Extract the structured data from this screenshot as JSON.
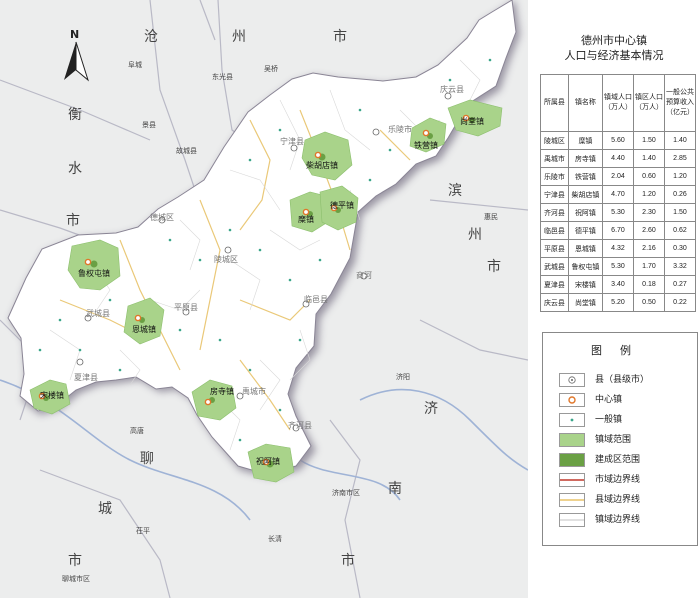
{
  "map": {
    "outside_labels": [
      {
        "id": "cang1",
        "text": "沧"
      },
      {
        "id": "zhou1",
        "text": "州"
      },
      {
        "id": "shi1",
        "text": "市"
      },
      {
        "id": "heng",
        "text": "衡"
      },
      {
        "id": "shui",
        "text": "水"
      },
      {
        "id": "shi2",
        "text": "市"
      },
      {
        "id": "bin",
        "text": "滨"
      },
      {
        "id": "zhou2",
        "text": "州"
      },
      {
        "id": "shi3",
        "text": "市"
      },
      {
        "id": "ji",
        "text": "济"
      },
      {
        "id": "nan",
        "text": "南"
      },
      {
        "id": "shi4",
        "text": "市"
      },
      {
        "id": "liao",
        "text": "聊"
      },
      {
        "id": "cheng",
        "text": "城"
      },
      {
        "id": "shi5",
        "text": "市"
      }
    ],
    "county_labels": [
      {
        "id": "ningjin",
        "text": "宁津县"
      },
      {
        "id": "laoling",
        "text": "乐陵市"
      },
      {
        "id": "qingyun",
        "text": "庆云县"
      },
      {
        "id": "decheng",
        "text": "德城区"
      },
      {
        "id": "lingcheng",
        "text": "陵城区"
      },
      {
        "id": "wucheng",
        "text": "武城县"
      },
      {
        "id": "pingyuan",
        "text": "平原县"
      },
      {
        "id": "linyi",
        "text": "临邑县"
      },
      {
        "id": "xiajin",
        "text": "夏津县"
      },
      {
        "id": "yucheng",
        "text": "禹城市"
      },
      {
        "id": "qihe",
        "text": "齐河县"
      },
      {
        "id": "shanghe",
        "text": "商河"
      }
    ],
    "outside_city_labels": [
      {
        "id": "jingxian",
        "text": "景县"
      },
      {
        "id": "gucheng",
        "text": "故城县"
      },
      {
        "id": "dongguang",
        "text": "东光县"
      },
      {
        "id": "fucheng",
        "text": "阜城"
      },
      {
        "id": "wuqiao",
        "text": "吴桥"
      },
      {
        "id": "huimin",
        "text": "惠民"
      },
      {
        "id": "jiyang",
        "text": "济阳"
      },
      {
        "id": "jinan",
        "text": "济南市区"
      },
      {
        "id": "changqing",
        "text": "长清"
      },
      {
        "id": "gaotang",
        "text": "高唐"
      },
      {
        "id": "chiping",
        "text": "茌平"
      },
      {
        "id": "liaocheng",
        "text": "聊城市区"
      }
    ],
    "towns": [
      {
        "id": "chaihudian",
        "text": "柴胡店镇"
      },
      {
        "id": "tiejia",
        "text": "铁营镇"
      },
      {
        "id": "shangtang",
        "text": "尚堂镇"
      },
      {
        "id": "deping",
        "text": "德平镇"
      },
      {
        "id": "mi",
        "text": "糜镇"
      },
      {
        "id": "luquantun",
        "text": "鲁权屯镇"
      },
      {
        "id": "encheng",
        "text": "恩城镇"
      },
      {
        "id": "songlou",
        "text": "宋楼镇"
      },
      {
        "id": "fangsi",
        "text": "房寺镇"
      },
      {
        "id": "zhuahe",
        "text": "祝阿镇"
      }
    ],
    "north": "N"
  },
  "panel": {
    "title_line1": "德州市中心镇",
    "title_line2": "人口与经济基本情况",
    "headers": [
      "所属县",
      "镇名称",
      "镇域人口（万人）",
      "镇区人口（万人）",
      "一般公共预算收入（亿元）"
    ],
    "rows": [
      [
        "陵城区",
        "糜镇",
        "5.60",
        "1.50",
        "1.40"
      ],
      [
        "禹城市",
        "房寺镇",
        "4.40",
        "1.40",
        "2.85"
      ],
      [
        "乐陵市",
        "铁营镇",
        "2.04",
        "0.60",
        "1.20"
      ],
      [
        "宁津县",
        "柴胡店镇",
        "4.70",
        "1.20",
        "0.26"
      ],
      [
        "齐河县",
        "祝阿镇",
        "5.30",
        "2.30",
        "1.50"
      ],
      [
        "临邑县",
        "德平镇",
        "6.70",
        "2.60",
        "0.62"
      ],
      [
        "平原县",
        "恩城镇",
        "4.32",
        "2.16",
        "0.30"
      ],
      [
        "武城县",
        "鲁权屯镇",
        "5.30",
        "1.70",
        "3.32"
      ],
      [
        "夏津县",
        "宋楼镇",
        "3.40",
        "0.18",
        "0.27"
      ],
      [
        "庆云县",
        "尚堂镇",
        "5.20",
        "0.50",
        "0.22"
      ]
    ]
  },
  "legend": {
    "title": "图例",
    "items": [
      {
        "id": "county",
        "text": "县（县级市）"
      },
      {
        "id": "center_town",
        "text": "中心镇"
      },
      {
        "id": "general_town",
        "text": "一般镇"
      },
      {
        "id": "town_area",
        "text": "镇域范围"
      },
      {
        "id": "built_area",
        "text": "建成区范围"
      },
      {
        "id": "city_border",
        "text": "市域边界线"
      },
      {
        "id": "county_border",
        "text": "县域边界线"
      },
      {
        "id": "town_border",
        "text": "镇域边界线"
      }
    ],
    "colors": {
      "town_area": "#a9d38a",
      "built_area": "#6aa044",
      "city_border": "#c0392b",
      "county_border": "#e8c36a",
      "region": "#ffffff",
      "outside": "#eceded",
      "shadow": "#8a8595"
    }
  }
}
